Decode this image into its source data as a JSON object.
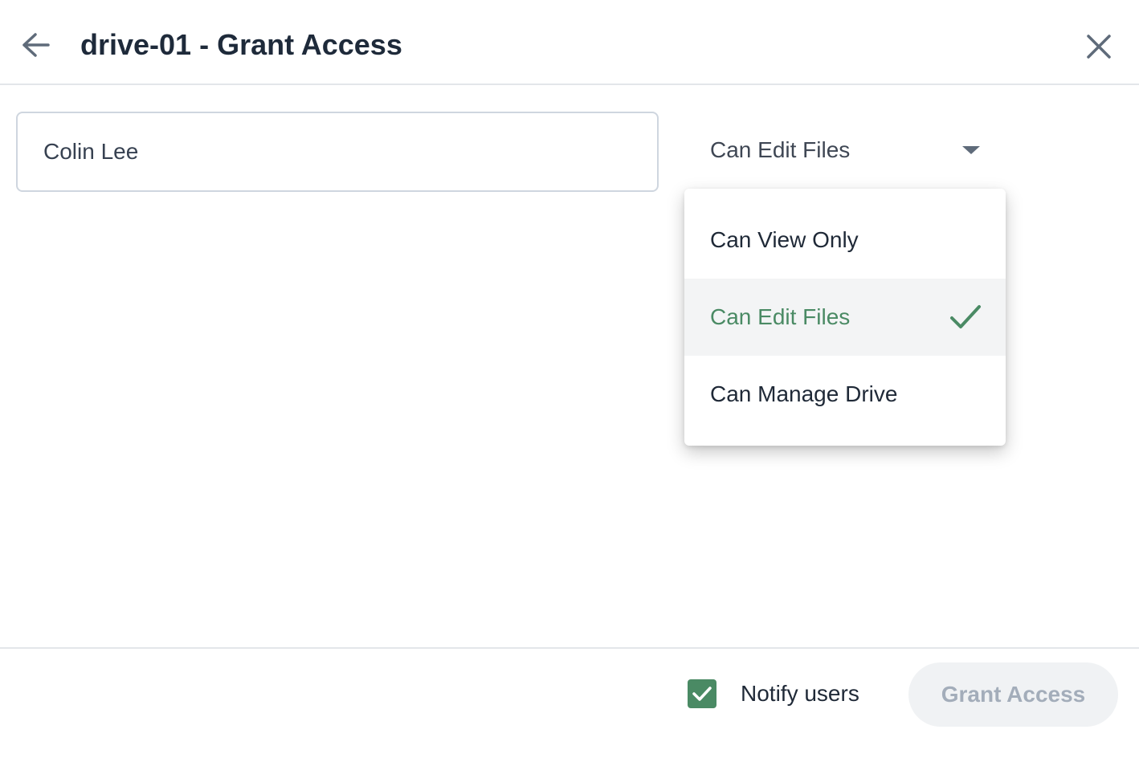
{
  "header": {
    "title": "drive-01 - Grant Access",
    "back_icon": "arrow-left-icon",
    "close_icon": "close-icon"
  },
  "form": {
    "user_value": "Colin Lee",
    "permission": {
      "selected": "Can Edit Files",
      "options": [
        {
          "label": "Can View Only",
          "selected": false
        },
        {
          "label": "Can Edit Files",
          "selected": true
        },
        {
          "label": "Can Manage Drive",
          "selected": false
        }
      ]
    }
  },
  "footer": {
    "notify_label": "Notify users",
    "notify_checked": true,
    "grant_label": "Grant Access",
    "grant_disabled": true
  },
  "colors": {
    "accent": "#4a8a64",
    "title": "#1e2a3a",
    "disabled_text": "#a3adba",
    "disabled_bg": "#f0f2f4"
  }
}
